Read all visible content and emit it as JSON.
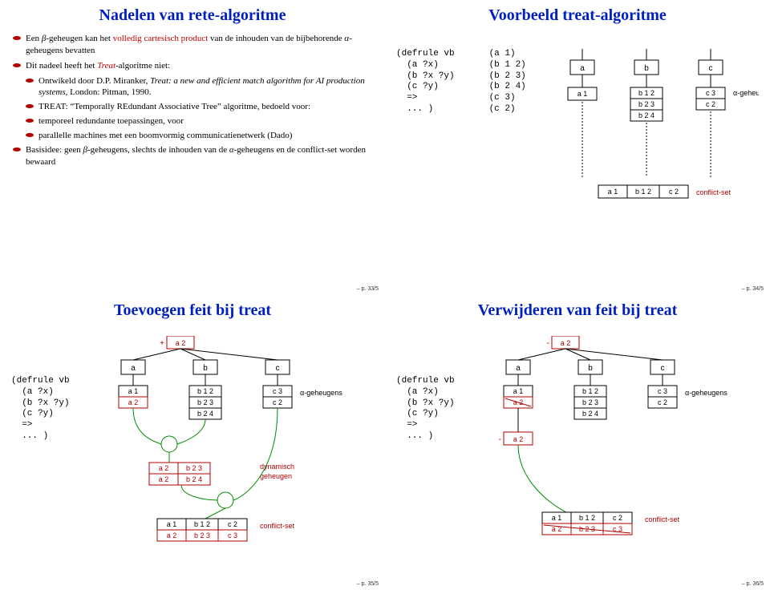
{
  "slide1": {
    "title": "Nadelen van rete-algoritme",
    "bullets": [
      {
        "level": 1,
        "html": "Een <i>β</i>-geheugen kan het <span class='red'>volledig cartesisch product</span> van de inhouden van de bijbehorende <i>α</i>-geheugens bevatten"
      },
      {
        "level": 1,
        "html": "Dit nadeel heeft het <span class='red ital'>Treat</span>-algoritme niet:"
      },
      {
        "level": 2,
        "html": "Ontwikeld door D.P. Miranker, <i>Treat: a new and efficient match algorithm for AI production systems</i>, London: Pitman, 1990."
      },
      {
        "level": 2,
        "html": "TREAT: “Temporally REdundant Associative Tree” algoritme, bedoeld voor:"
      },
      {
        "level": 2,
        "html": "temporeel redundante toepassingen, voor"
      },
      {
        "level": 2,
        "html": "parallelle machines met een boomvormig communicatienetwerk (Dado)"
      },
      {
        "level": 1,
        "html": "Basisidee: geen <i>β</i>-geheugens, slechts de inhouden van de <i>α</i>-geheugens en de conflict-set worden bewaard"
      }
    ],
    "page": "– p. 33/5"
  },
  "slide2": {
    "title": "Voorbeeld treat-algoritme",
    "code_left": "(defrule vb\n  (a ?x)\n  (b ?x ?y)\n  (c ?y)\n  =>\n  ... )",
    "code_right": "(a 1)\n(b 1 2)\n(b 2 3)\n(b 2 4)\n(c 3)\n(c 2)",
    "columns": {
      "a": [
        "a 1"
      ],
      "b": [
        "b 1 2",
        "b 2 3",
        "b 2 4"
      ],
      "c": [
        "c 3",
        "c 2"
      ]
    },
    "alpha_label": "α-geheugens",
    "conflict_label": "conflict-set",
    "conflict": [
      "a 1",
      "b 1 2",
      "c 2"
    ],
    "page": "– p. 34/5"
  },
  "slide3": {
    "title": "Toevoegen feit bij treat",
    "new_fact": "+ a 2",
    "code": "(defrule vb\n  (a ?x)\n  (b ?x ?y)\n  (c ?y)\n  =>\n  ... )",
    "columns": {
      "a": [
        "a 1",
        "a 2"
      ],
      "b": [
        "b 1 2",
        "b 2 3",
        "b 2 4"
      ],
      "c": [
        "c 3",
        "c 2"
      ]
    },
    "alpha_label": "α-geheugens",
    "dyn_label": "dynamisch\ngeheugen",
    "dyn_rows": [
      [
        "a 2",
        "b 2 3"
      ],
      [
        "a 2",
        "b 2 4"
      ]
    ],
    "conflict_label": "conflict-set",
    "conflict": [
      [
        "a 1",
        "b 1 2",
        "c 2"
      ],
      [
        "a 2",
        "b 2 3",
        "c 3"
      ]
    ],
    "page": "– p. 35/5"
  },
  "slide4": {
    "title": "Verwijderen van feit bij treat",
    "del_fact": "- a 2",
    "del_below": "- a 2",
    "code": "(defrule vb\n  (a ?x)\n  (b ?x ?y)\n  (c ?y)\n  =>\n  ... )",
    "columns": {
      "a": [
        "a 1",
        "a 2"
      ],
      "b": [
        "b 1 2",
        "b 2 3",
        "b 2 4"
      ],
      "c": [
        "c 3",
        "c 2"
      ]
    },
    "alpha_label": "α-geheugens",
    "conflict_label": "conflict-set",
    "conflict": [
      [
        "a 1",
        "b 1 2",
        "c 2"
      ],
      [
        "a 2",
        "b 2 3",
        "c 3"
      ]
    ],
    "page": "– p. 36/5"
  }
}
